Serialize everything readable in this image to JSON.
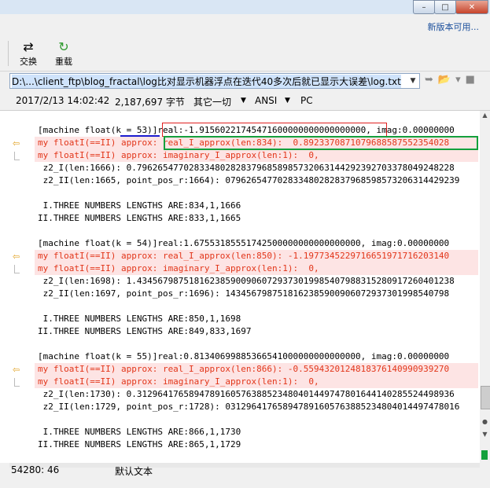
{
  "window": {
    "minimize": "–",
    "maximize": "□",
    "close": "✕"
  },
  "topbar": {
    "new_version": "新版本可用..."
  },
  "toolbar": {
    "swap_label": "交换",
    "reload_label": "重载"
  },
  "path": {
    "value": "D:\\...\\client_ftp\\blog_fractal\\log比对显示机器浮点在迭代40多次后就已显示大误差\\log.txt"
  },
  "info": {
    "date": "2017/2/13 14:02:42",
    "size": "2,187,697 字节",
    "format": "其它一切",
    "encoding": "ANSI",
    "lineend": "PC"
  },
  "lines": [
    "[machine float(k = 53)]real:-1.91560221745471600000000000000000, imag:0.00000000",
    "my floatI(==II) approx: real_I_approx(len:834):  0.8923370871079688587552354028",
    "my floatI(==II) approx: imaginary_I_approx(len:1):  0,",
    " z2_I(len:1666): 0.7962654770283348028283796858985732063144292392703378049248228",
    " z2_II(len:1665, point_pos_r:1664): 079626547702833480282837968598573206314429239",
    "",
    " I.THREE NUMBERS LENGTHS ARE:834,1,1666",
    "II.THREE NUMBERS LENGTHS ARE:833,1,1665",
    "",
    "[machine float(k = 54)]real:1.67553185551742500000000000000000, imag:0.00000000",
    "my floatI(==II) approx: real_I_approx(len:850): -1.1977345229716651971716203140",
    "my floatI(==II) approx: imaginary_I_approx(len:1):  0,",
    " z2_I(len:1698): 1.4345679875181623859009060729373019985407988315280917260401238",
    " z2_II(len:1697, point_pos_r:1696): 1434567987518162385900906072937301998540798",
    "",
    " I.THREE NUMBERS LENGTHS ARE:850,1,1698",
    "II.THREE NUMBERS LENGTHS ARE:849,833,1697",
    "",
    "[machine float(k = 55)]real:0.81340699885366541000000000000000, imag:0.00000000",
    "my floatI(==II) approx: real_I_approx(len:866): -0.5594320124818376140990939270",
    "my floatI(==II) approx: imaginary_I_approx(len:1):  0,",
    " z2_I(len:1730): 0.3129641765894789160576388523480401449747801644140285524498936",
    " z2_II(len:1729, point_pos_r:1728): 031296417658947891605763885234804014497478016",
    "",
    " I.THREE NUMBERS LENGTHS ARE:866,1,1730",
    "II.THREE NUMBERS LENGTHS ARE:865,1,1729"
  ],
  "status": {
    "position": "54280: 46",
    "mode": "默认文本"
  }
}
